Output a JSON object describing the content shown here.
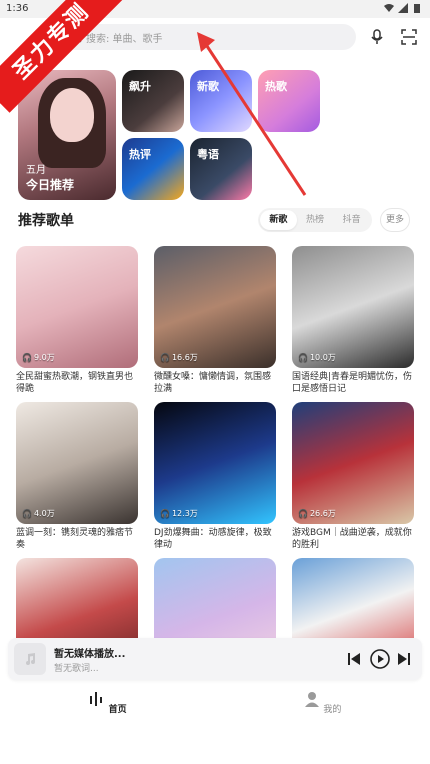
{
  "status": {
    "time": "1:36"
  },
  "watermark": "圣力专测",
  "search": {
    "placeholder": "搜索: 单曲、歌手"
  },
  "featured": {
    "date": "五月",
    "label": "今日推荐"
  },
  "tiles": [
    {
      "label": "飙升"
    },
    {
      "label": "新歌"
    },
    {
      "label": "热歌"
    },
    {
      "label": "热评"
    },
    {
      "label": "粤语"
    }
  ],
  "section": {
    "title": "推荐歌单",
    "tabs": [
      "新歌",
      "热榜",
      "抖音"
    ],
    "active_tab": "新歌",
    "more": "更多"
  },
  "playlists": [
    {
      "count": "9.0万",
      "title": "全民甜蜜热歌潮，钢铁直男也得跪"
    },
    {
      "count": "16.6万",
      "title": "微醺女嗓：慵懒情调，氛围感拉满"
    },
    {
      "count": "10.0万",
      "title": "国语经典|青春是明媚忧伤，伤口是感悟日记"
    },
    {
      "count": "4.0万",
      "title": "蓝调一刻：镌刻灵魂的雅痞节奏"
    },
    {
      "count": "12.3万",
      "title": "DJ劲爆舞曲：动感旋律，极致律动"
    },
    {
      "count": "26.6万",
      "title": "游戏BGM｜战曲逆袭，成就你的胜利"
    },
    {
      "count": "",
      "title": ""
    },
    {
      "count": "",
      "title": ""
    },
    {
      "count": "",
      "title": ""
    }
  ],
  "player": {
    "title": "暂无媒体播放...",
    "subtitle": "暂无歌词..."
  },
  "tabbar": {
    "home": "首页",
    "me": "我的"
  },
  "colors": {
    "watermark": "#e51c1c",
    "arrow": "#e53935",
    "searchbar": "#f1f1f3"
  }
}
